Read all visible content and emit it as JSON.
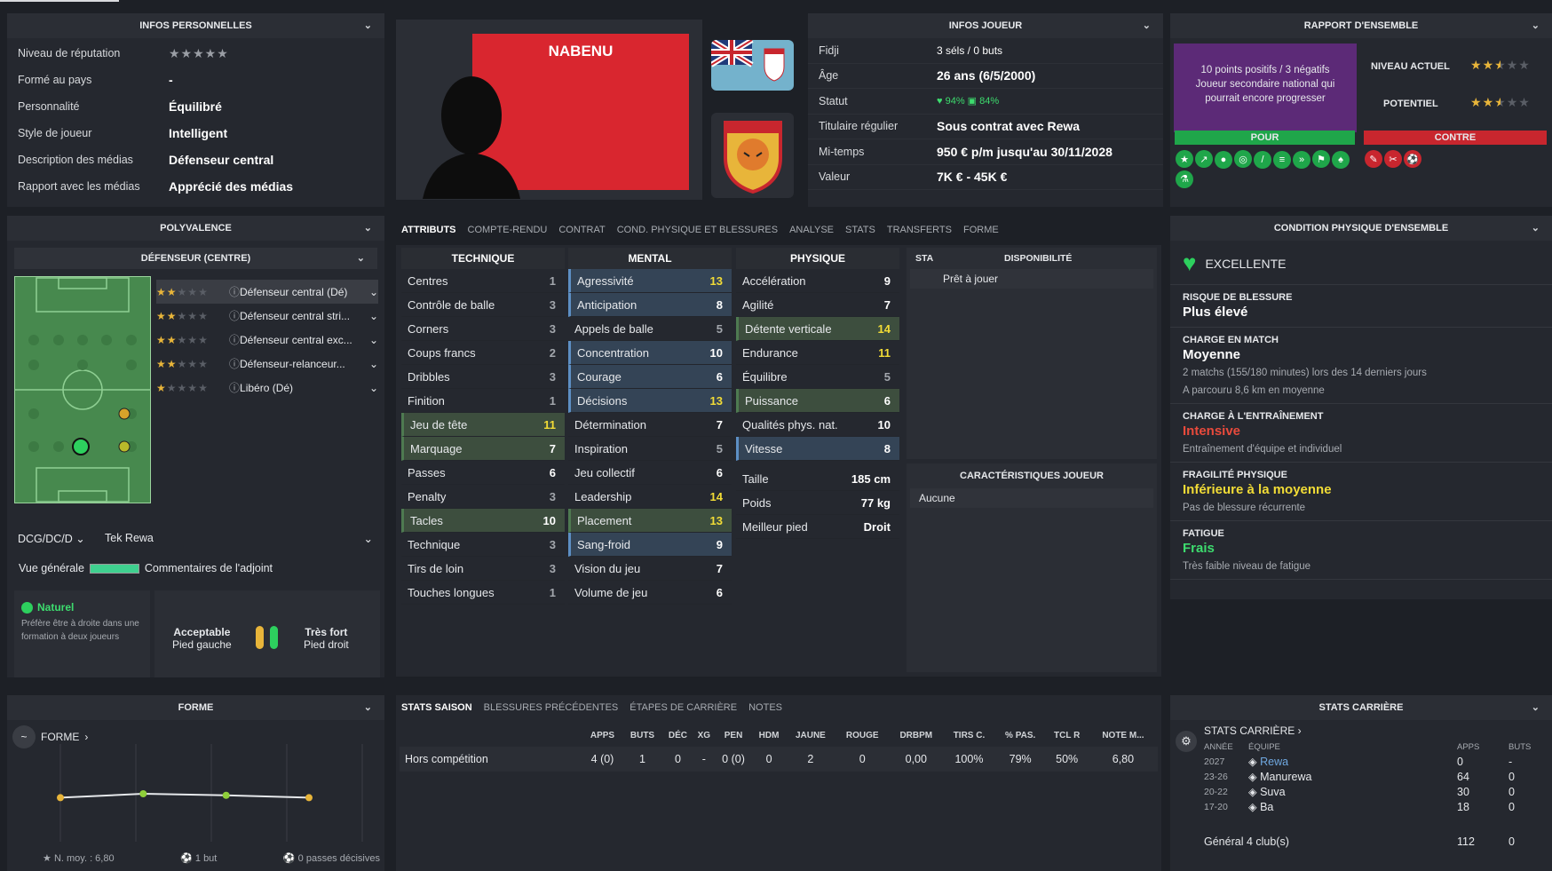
{
  "personal": {
    "title": "INFOS PERSONNELLES",
    "rows": [
      {
        "label": "Niveau de réputation",
        "value": "★★★★★",
        "type": "stars"
      },
      {
        "label": "Formé au pays",
        "value": "-"
      },
      {
        "label": "Personnalité",
        "value": "Équilibré"
      },
      {
        "label": "Style de joueur",
        "value": "Intelligent"
      },
      {
        "label": "Description des médias",
        "value": "Défenseur central"
      },
      {
        "label": "Rapport avec les médias",
        "value": "Apprécié des médias"
      }
    ]
  },
  "player": {
    "name": "NABENU"
  },
  "info": {
    "title": "INFOS JOUEUR",
    "rows": [
      {
        "label": "Fidji",
        "value": "3 séls / 0 buts"
      },
      {
        "label": "Âge",
        "value": "26 ans (6/5/2000)"
      },
      {
        "label": "Statut",
        "value": ""
      },
      {
        "label": "Titulaire régulier",
        "value": "Sous contrat avec Rewa"
      },
      {
        "label": "Mi-temps",
        "value": "950 € p/m jusqu'au 30/11/2028"
      },
      {
        "label": "Valeur",
        "value": "7K € - 45K €"
      }
    ],
    "status_a": "94%",
    "status_b": "84%"
  },
  "report": {
    "title": "RAPPORT D'ENSEMBLE",
    "summary_1": "10 points positifs / 3 négatifs",
    "summary_2": "Joueur secondaire national qui pourrait encore progresser",
    "niveau_label": "NIVEAU ACTUEL",
    "potentiel_label": "POTENTIEL",
    "pour": "POUR",
    "contre": "CONTRE",
    "niveau": 2.5,
    "potentiel": 2.5
  },
  "poly": {
    "title": "POLYVALENCE",
    "sub": "DÉFENSEUR (CENTRE)",
    "roles": [
      {
        "label": "Défenseur central (Dé)",
        "stars": 2
      },
      {
        "label": "Défenseur central stri...",
        "stars": 2
      },
      {
        "label": "Défenseur central exc...",
        "stars": 2
      },
      {
        "label": "Défenseur-relanceur...",
        "stars": 2
      },
      {
        "label": "Libéro (Dé)",
        "stars": 1
      }
    ],
    "pos_select": "DCG/DC/D",
    "team_select": "Tek Rewa",
    "overview": "Vue générale",
    "comments": "Commentaires de l'adjoint",
    "natural_title": "Naturel",
    "natural_desc": "Préfère être à droite dans une formation à deux joueurs",
    "foot_left_q": "Acceptable",
    "foot_left": "Pied gauche",
    "foot_right_q": "Très fort",
    "foot_right": "Pied droit"
  },
  "tabs": [
    "ATTRIBUTS",
    "COMPTE-RENDU",
    "CONTRAT",
    "COND. PHYSIQUE ET BLESSURES",
    "ANALYSE",
    "STATS",
    "TRANSFERTS",
    "FORME"
  ],
  "attr": {
    "technique_title": "TECHNIQUE",
    "mental_title": "MENTAL",
    "physique_title": "PHYSIQUE",
    "technique": [
      [
        "Centres",
        "1",
        ""
      ],
      [
        "Contrôle de balle",
        "3",
        ""
      ],
      [
        "Corners",
        "3",
        ""
      ],
      [
        "Coups francs",
        "2",
        ""
      ],
      [
        "Dribbles",
        "3",
        ""
      ],
      [
        "Finition",
        "1",
        ""
      ],
      [
        "Jeu de tête",
        "11",
        "G"
      ],
      [
        "Marquage",
        "7",
        "G"
      ],
      [
        "Passes",
        "6",
        ""
      ],
      [
        "Penalty",
        "3",
        ""
      ],
      [
        "Tacles",
        "10",
        "G"
      ],
      [
        "Technique",
        "3",
        ""
      ],
      [
        "Tirs de loin",
        "3",
        ""
      ],
      [
        "Touches longues",
        "1",
        ""
      ]
    ],
    "mental": [
      [
        "Agressivité",
        "13",
        "B"
      ],
      [
        "Anticipation",
        "8",
        "B"
      ],
      [
        "Appels de balle",
        "5",
        ""
      ],
      [
        "Concentration",
        "10",
        "B"
      ],
      [
        "Courage",
        "6",
        "B"
      ],
      [
        "Décisions",
        "13",
        "B"
      ],
      [
        "Détermination",
        "7",
        ""
      ],
      [
        "Inspiration",
        "5",
        ""
      ],
      [
        "Jeu collectif",
        "6",
        ""
      ],
      [
        "Leadership",
        "14",
        ""
      ],
      [
        "Placement",
        "13",
        "G"
      ],
      [
        "Sang-froid",
        "9",
        "B"
      ],
      [
        "Vision du jeu",
        "7",
        ""
      ],
      [
        "Volume de jeu",
        "6",
        ""
      ]
    ],
    "physique": [
      [
        "Accélération",
        "9",
        ""
      ],
      [
        "Agilité",
        "7",
        ""
      ],
      [
        "Détente verticale",
        "14",
        "G"
      ],
      [
        "Endurance",
        "11",
        ""
      ],
      [
        "Équilibre",
        "5",
        ""
      ],
      [
        "Puissance",
        "6",
        "G"
      ],
      [
        "Qualités phys. nat.",
        "10",
        ""
      ],
      [
        "Vitesse",
        "8",
        "B"
      ]
    ],
    "extra": [
      [
        "Taille",
        "185 cm"
      ],
      [
        "Poids",
        "77 kg"
      ],
      [
        "Meilleur pied",
        "Droit"
      ]
    ]
  },
  "avail": {
    "col1": "STA",
    "col2": "DISPONIBILITÉ",
    "value": "Prêt à jouer",
    "char_title": "CARACTÉRISTIQUES JOUEUR",
    "char_value": "Aucune"
  },
  "cond": {
    "title": "CONDITION PHYSIQUE D'ENSEMBLE",
    "state": "EXCELLENTE",
    "sections": [
      {
        "t": "RISQUE DE BLESSURE",
        "v": "Plus élevé",
        "c": "#ffffff",
        "s": ""
      },
      {
        "t": "CHARGE EN MATCH",
        "v": "Moyenne",
        "c": "#ffffff",
        "s": "2 matchs (155/180 minutes) lors des 14 derniers jours",
        "s2": "A parcouru 8,6 km en moyenne"
      },
      {
        "t": "CHARGE À L'ENTRAÎNEMENT",
        "v": "Intensive",
        "c": "#e84a3c",
        "s": "Entraînement d'équipe et individuel"
      },
      {
        "t": "FRAGILITÉ PHYSIQUE",
        "v": "Inférieure à la moyenne",
        "c": "#f2dc36",
        "s": "Pas de blessure récurrente"
      },
      {
        "t": "FATIGUE",
        "v": "Frais",
        "c": "#3ddc6e",
        "s": "Très faible niveau de fatigue"
      }
    ]
  },
  "form": {
    "title": "FORME",
    "link": "FORME",
    "avg": "N. moy. : 6,80",
    "goals": "1 but",
    "assists": "0 passes décisives",
    "points": [
      0.45,
      0.5,
      0.48,
      0.45
    ]
  },
  "season": {
    "tabs": [
      "STATS SAISON",
      "BLESSURES PRÉCÉDENTES",
      "ÉTAPES DE CARRIÈRE",
      "NOTES"
    ],
    "headers": [
      "APPS",
      "BUTS",
      "DÉC",
      "XG",
      "PEN",
      "HDM",
      "JAUNE",
      "ROUGE",
      "DRBPM",
      "TIRS C.",
      "% PAS.",
      "TCL R",
      "NOTE M..."
    ],
    "row_label": "Hors compétition",
    "row": [
      "4 (0)",
      "1",
      "0",
      "-",
      "0 (0)",
      "0",
      "2",
      "0",
      "0,00",
      "100%",
      "79%",
      "50%",
      "6,80"
    ]
  },
  "career": {
    "title": "STATS CARRIÈRE",
    "link": "STATS CARRIÈRE",
    "h_year": "ANNÉE",
    "h_team": "ÉQUIPE",
    "h_apps": "APPS",
    "h_goals": "BUTS",
    "rows": [
      [
        "2027",
        "Rewa",
        "0",
        "-"
      ],
      [
        "23-26",
        "Manurewa",
        "64",
        "0"
      ],
      [
        "20-22",
        "Suva",
        "30",
        "0"
      ],
      [
        "17-20",
        "Ba",
        "18",
        "0"
      ]
    ],
    "total_label": "Général 4 club(s)",
    "total_apps": "112",
    "total_goals": "0"
  },
  "colors": {
    "accent": "#4e7a51",
    "purple": "#5c2a77",
    "green": "#1fa64a",
    "red": "#c8262e"
  }
}
